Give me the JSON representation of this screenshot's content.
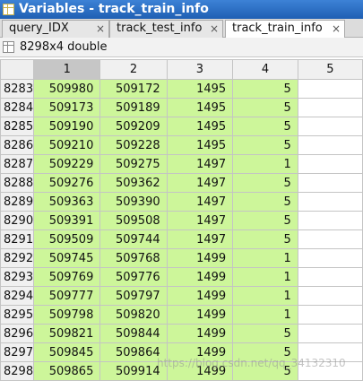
{
  "window": {
    "title": "Variables - track_train_info"
  },
  "tabs": [
    {
      "label": "query_IDX",
      "close": "×"
    },
    {
      "label": "track_test_info",
      "close": "×"
    },
    {
      "label": "track_train_info",
      "close": "×"
    }
  ],
  "info": {
    "text": "8298x4 double"
  },
  "table": {
    "columns": [
      "1",
      "2",
      "3",
      "4",
      "5"
    ],
    "rows": [
      {
        "h": "8283",
        "c": [
          "509980",
          "509172",
          "1495",
          "5",
          ""
        ]
      },
      {
        "h": "8284",
        "c": [
          "509173",
          "509189",
          "1495",
          "5",
          ""
        ]
      },
      {
        "h": "8285",
        "c": [
          "509190",
          "509209",
          "1495",
          "5",
          ""
        ]
      },
      {
        "h": "8286",
        "c": [
          "509210",
          "509228",
          "1495",
          "5",
          ""
        ]
      },
      {
        "h": "8287",
        "c": [
          "509229",
          "509275",
          "1497",
          "1",
          ""
        ]
      },
      {
        "h": "8288",
        "c": [
          "509276",
          "509362",
          "1497",
          "5",
          ""
        ]
      },
      {
        "h": "8289",
        "c": [
          "509363",
          "509390",
          "1497",
          "5",
          ""
        ]
      },
      {
        "h": "8290",
        "c": [
          "509391",
          "509508",
          "1497",
          "5",
          ""
        ]
      },
      {
        "h": "8291",
        "c": [
          "509509",
          "509744",
          "1497",
          "5",
          ""
        ]
      },
      {
        "h": "8292",
        "c": [
          "509745",
          "509768",
          "1499",
          "1",
          ""
        ]
      },
      {
        "h": "8293",
        "c": [
          "509769",
          "509776",
          "1499",
          "1",
          ""
        ]
      },
      {
        "h": "8294",
        "c": [
          "509777",
          "509797",
          "1499",
          "1",
          ""
        ]
      },
      {
        "h": "8295",
        "c": [
          "509798",
          "509820",
          "1499",
          "1",
          ""
        ]
      },
      {
        "h": "8296",
        "c": [
          "509821",
          "509844",
          "1499",
          "5",
          ""
        ]
      },
      {
        "h": "8297",
        "c": [
          "509845",
          "509864",
          "1499",
          "5",
          ""
        ]
      },
      {
        "h": "8298",
        "c": [
          "509865",
          "509914",
          "1499",
          "5",
          ""
        ]
      }
    ]
  },
  "watermark": "https://blog.csdn.net/qq_34132310",
  "colors": {
    "title_bar": "#2a6fc4",
    "cell_fill": "#cdf69a",
    "selected_header": "#c6c6c6"
  }
}
